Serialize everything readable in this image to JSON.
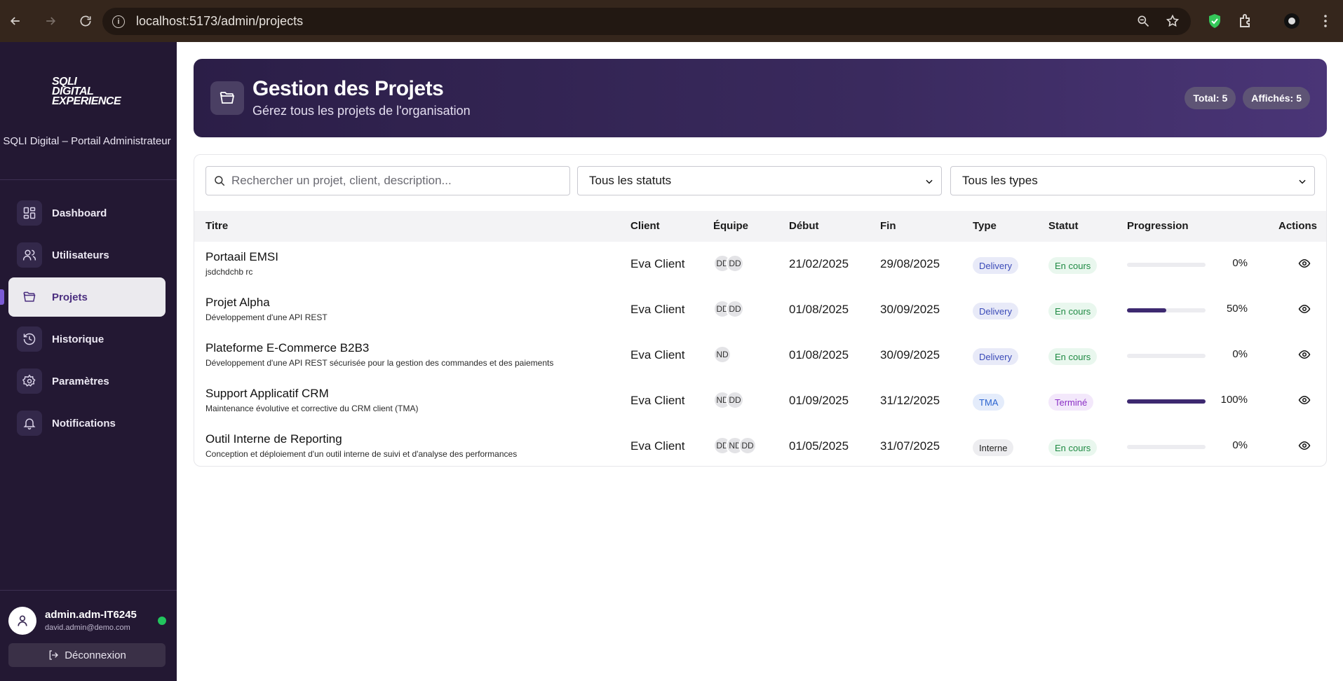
{
  "browser": {
    "url": "localhost:5173/admin/projects"
  },
  "sidebar": {
    "logo_lines": [
      "SQLI",
      "DIGITAL",
      "EXPERIENCE"
    ],
    "portal_title": "SQLI Digital – Portail Administrateur",
    "items": [
      {
        "label": "Dashboard",
        "icon": "dashboard-icon"
      },
      {
        "label": "Utilisateurs",
        "icon": "users-icon"
      },
      {
        "label": "Projets",
        "icon": "folder-icon",
        "active": true
      },
      {
        "label": "Historique",
        "icon": "history-icon"
      },
      {
        "label": "Paramètres",
        "icon": "gear-icon"
      },
      {
        "label": "Notifications",
        "icon": "bell-icon"
      }
    ],
    "user": {
      "name": "admin.adm-IT6245",
      "email": "david.admin@demo.com",
      "status_color": "#22c55e"
    },
    "logout_label": "Déconnexion"
  },
  "header": {
    "title": "Gestion des Projets",
    "subtitle": "Gérez tous les projets de l'organisation",
    "total_label": "Total:",
    "total_value": "5",
    "shown_label": "Affichés:",
    "shown_value": "5"
  },
  "filters": {
    "search_placeholder": "Rechercher un projet, client, description...",
    "status_selected": "Tous les statuts",
    "type_selected": "Tous les types"
  },
  "table": {
    "columns": [
      "Titre",
      "Client",
      "Équipe",
      "Début",
      "Fin",
      "Type",
      "Statut",
      "Progression",
      "Actions"
    ],
    "rows": [
      {
        "title": "Portaail EMSI",
        "desc": "jsdchdchb rc",
        "client": "Eva Client",
        "team": [
          "DD",
          "DD"
        ],
        "start": "21/02/2025",
        "end": "29/08/2025",
        "type": "Delivery",
        "status": "En cours",
        "progress": 0,
        "pct": "0%"
      },
      {
        "title": "Projet Alpha",
        "desc": "Développement d'une API REST",
        "client": "Eva Client",
        "team": [
          "DD",
          "DD"
        ],
        "start": "01/08/2025",
        "end": "30/09/2025",
        "type": "Delivery",
        "status": "En cours",
        "progress": 50,
        "pct": "50%"
      },
      {
        "title": "Plateforme E-Commerce B2B3",
        "desc": "Développement d'une API REST sécurisée pour la gestion des commandes et des paiements",
        "client": "Eva Client",
        "team": [
          "ND"
        ],
        "start": "01/08/2025",
        "end": "30/09/2025",
        "type": "Delivery",
        "status": "En cours",
        "progress": 0,
        "pct": "0%"
      },
      {
        "title": "Support Applicatif CRM",
        "desc": "Maintenance évolutive et corrective du CRM client (TMA)",
        "client": "Eva Client",
        "team": [
          "ND",
          "DD"
        ],
        "start": "01/09/2025",
        "end": "31/12/2025",
        "type": "TMA",
        "status": "Terminé",
        "progress": 100,
        "pct": "100%"
      },
      {
        "title": "Outil Interne de Reporting",
        "desc": "Conception et déploiement d'un outil interne de suivi et d'analyse des performances",
        "client": "Eva Client",
        "team": [
          "DD",
          "ND",
          "DD"
        ],
        "start": "01/05/2025",
        "end": "31/07/2025",
        "type": "Interne",
        "status": "En cours",
        "progress": 0,
        "pct": "0%"
      }
    ]
  },
  "colors": {
    "sidebar_bg": "#231833",
    "accent": "#3d2970",
    "hero_gradient_start": "#2b1e47",
    "hero_gradient_end": "#4a3577"
  }
}
